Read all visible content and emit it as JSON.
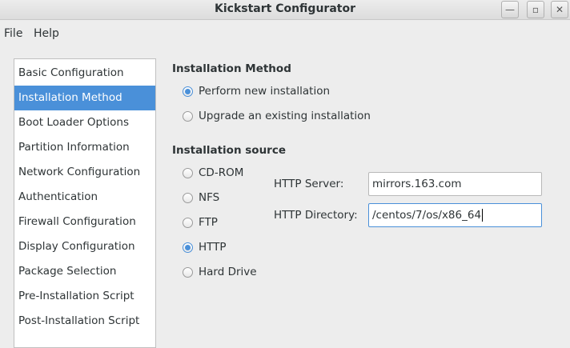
{
  "window": {
    "title": "Kickstart Configurator",
    "controls": {
      "minimize": "—",
      "maximize": "▫",
      "close": "✕"
    }
  },
  "menubar": {
    "items": [
      {
        "label": "File"
      },
      {
        "label": "Help"
      }
    ]
  },
  "sidebar": {
    "selected": "Installation Method",
    "items": [
      {
        "label": "Basic Configuration"
      },
      {
        "label": "Installation Method"
      },
      {
        "label": "Boot Loader Options"
      },
      {
        "label": "Partition Information"
      },
      {
        "label": "Network Configuration"
      },
      {
        "label": "Authentication"
      },
      {
        "label": "Firewall Configuration"
      },
      {
        "label": "Display Configuration"
      },
      {
        "label": "Package Selection"
      },
      {
        "label": "Pre-Installation Script"
      },
      {
        "label": "Post-Installation Script"
      }
    ]
  },
  "installation_method": {
    "heading": "Installation Method",
    "options": [
      {
        "label": "Perform new installation",
        "checked": true
      },
      {
        "label": "Upgrade an existing installation",
        "checked": false
      }
    ]
  },
  "installation_source": {
    "heading": "Installation source",
    "options": [
      {
        "label": "CD-ROM",
        "checked": false
      },
      {
        "label": "NFS",
        "checked": false
      },
      {
        "label": "FTP",
        "checked": false
      },
      {
        "label": "HTTP",
        "checked": true
      },
      {
        "label": "Hard Drive",
        "checked": false
      }
    ],
    "http_server": {
      "label": "HTTP Server:",
      "value": "mirrors.163.com"
    },
    "http_directory": {
      "label": "HTTP Directory:",
      "value": "/centos/7/os/x86_64"
    }
  },
  "colors": {
    "accent": "#4a90d9",
    "background": "#ededed"
  }
}
